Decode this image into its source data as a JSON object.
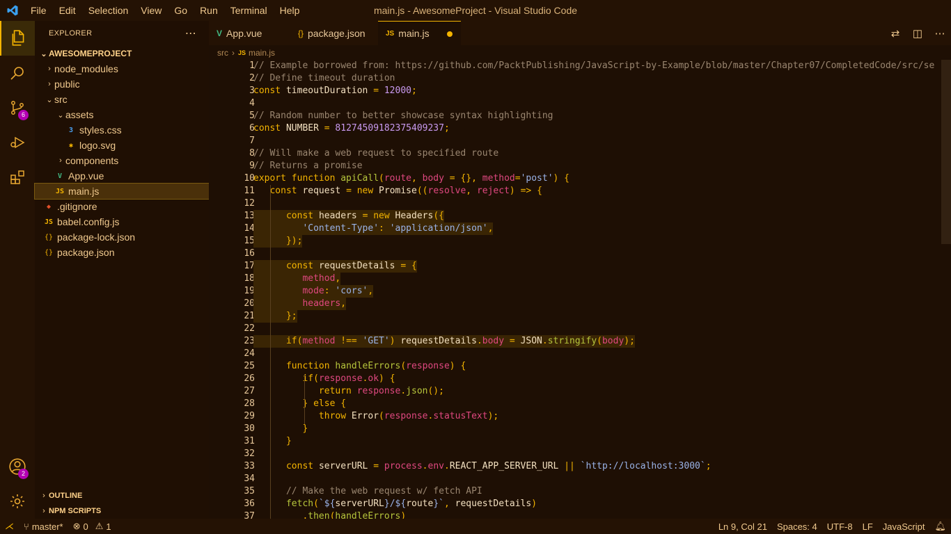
{
  "window": {
    "title": "main.js - AwesomeProject - Visual Studio Code"
  },
  "menu": [
    "File",
    "Edit",
    "Selection",
    "View",
    "Go",
    "Run",
    "Terminal",
    "Help"
  ],
  "activity": {
    "scm_badge": "6",
    "accounts_badge": "2"
  },
  "sidebar": {
    "title": "EXPLORER",
    "project": "AWESOMEPROJECT",
    "items": [
      {
        "label": "node_modules",
        "type": "folder",
        "depth": 1,
        "open": false
      },
      {
        "label": "public",
        "type": "folder",
        "depth": 1,
        "open": false
      },
      {
        "label": "src",
        "type": "folder",
        "depth": 1,
        "open": true
      },
      {
        "label": "assets",
        "type": "folder",
        "depth": 2,
        "open": true
      },
      {
        "label": "styles.css",
        "type": "css",
        "depth": 3
      },
      {
        "label": "logo.svg",
        "type": "svg",
        "depth": 3
      },
      {
        "label": "components",
        "type": "folder",
        "depth": 2,
        "open": false
      },
      {
        "label": "App.vue",
        "type": "vue",
        "depth": 2
      },
      {
        "label": "main.js",
        "type": "js",
        "depth": 2,
        "selected": true
      },
      {
        "label": ".gitignore",
        "type": "git",
        "depth": 1
      },
      {
        "label": "babel.config.js",
        "type": "js",
        "depth": 1
      },
      {
        "label": "package-lock.json",
        "type": "json",
        "depth": 1
      },
      {
        "label": "package.json",
        "type": "json",
        "depth": 1
      }
    ],
    "outline": "OUTLINE",
    "npm_scripts": "NPM SCRIPTS"
  },
  "tabs": [
    {
      "label": "App.vue",
      "icon": "vue-icon"
    },
    {
      "label": "package.json",
      "icon": "json-icon"
    },
    {
      "label": "main.js",
      "icon": "js-icon",
      "active": true,
      "modified": true
    }
  ],
  "breadcrumb": {
    "folder": "src",
    "file": "main.js"
  },
  "code": [
    [
      [
        "c-com",
        "// Example borrowed from: https://github.com/PacktPublishing/JavaScript-by-Example/blob/master/Chapter07/CompletedCode/src/se"
      ]
    ],
    [
      [
        "c-com",
        "// Define timeout duration"
      ]
    ],
    [
      [
        "c-kw",
        "const "
      ],
      [
        "c-id",
        "timeoutDuration "
      ],
      [
        "c-kw",
        "= "
      ],
      [
        "c-num",
        "12000"
      ],
      [
        "c-kw",
        ";"
      ]
    ],
    [],
    [
      [
        "c-com",
        "// Random number to better showcase syntax highlighting"
      ]
    ],
    [
      [
        "c-kw",
        "const "
      ],
      [
        "c-id",
        "NUMBER "
      ],
      [
        "c-kw",
        "= "
      ],
      [
        "c-num",
        "81274509182375409237"
      ],
      [
        "c-kw",
        ";"
      ]
    ],
    [],
    [
      [
        "c-com",
        "// Will make a web request to specified route"
      ]
    ],
    [
      [
        "c-com",
        "// Returns a promise"
      ]
    ],
    [
      [
        "c-kw",
        "export function "
      ],
      [
        "c-fn",
        "apiCall"
      ],
      [
        "c-br",
        "("
      ],
      [
        "c-par",
        "route"
      ],
      [
        "c-kw",
        ", "
      ],
      [
        "c-par",
        "body "
      ],
      [
        "c-kw",
        "= "
      ],
      [
        "c-br",
        "{}"
      ],
      [
        "c-kw",
        ", "
      ],
      [
        "c-par",
        "method"
      ],
      [
        "c-kw",
        "="
      ],
      [
        "c-str",
        "'post'"
      ],
      [
        "c-br",
        ") {"
      ]
    ],
    [
      [
        "c-id",
        "   "
      ],
      [
        "c-kw",
        "const "
      ],
      [
        "c-id",
        "request "
      ],
      [
        "c-kw",
        "= new "
      ],
      [
        "c-id",
        "Promise"
      ],
      [
        "c-br",
        "(("
      ],
      [
        "c-par",
        "resolve"
      ],
      [
        "c-kw",
        ", "
      ],
      [
        "c-par",
        "reject"
      ],
      [
        "c-br",
        ") "
      ],
      [
        "c-kw",
        "=> "
      ],
      [
        "c-br",
        "{"
      ]
    ],
    [],
    [
      [
        "c-id",
        "      "
      ],
      [
        "c-kw",
        "const "
      ],
      [
        "c-id",
        "headers "
      ],
      [
        "c-kw",
        "= new "
      ],
      [
        "c-id",
        "Headers"
      ],
      [
        "c-br",
        "({"
      ]
    ],
    [
      [
        "c-id",
        "         "
      ],
      [
        "c-str",
        "'Content-Type'"
      ],
      [
        "c-kw",
        ": "
      ],
      [
        "c-str",
        "'application/json'"
      ],
      [
        "c-kw",
        ","
      ]
    ],
    [
      [
        "c-id",
        "      "
      ],
      [
        "c-br",
        "})"
      ],
      [
        "c-kw",
        ";"
      ]
    ],
    [],
    [
      [
        "c-id",
        "      "
      ],
      [
        "c-kw",
        "const "
      ],
      [
        "c-id",
        "requestDetails "
      ],
      [
        "c-kw",
        "= "
      ],
      [
        "c-br",
        "{"
      ]
    ],
    [
      [
        "c-id",
        "         "
      ],
      [
        "c-par",
        "method"
      ],
      [
        "c-kw",
        ","
      ]
    ],
    [
      [
        "c-id",
        "         "
      ],
      [
        "c-par",
        "mode"
      ],
      [
        "c-kw",
        ": "
      ],
      [
        "c-str",
        "'cors'"
      ],
      [
        "c-kw",
        ","
      ]
    ],
    [
      [
        "c-id",
        "         "
      ],
      [
        "c-par",
        "headers"
      ],
      [
        "c-kw",
        ","
      ]
    ],
    [
      [
        "c-id",
        "      "
      ],
      [
        "c-br",
        "}"
      ],
      [
        "c-kw",
        ";"
      ]
    ],
    [],
    [
      [
        "c-id",
        "      "
      ],
      [
        "c-kw",
        "if"
      ],
      [
        "c-br",
        "("
      ],
      [
        "c-par",
        "method "
      ],
      [
        "c-kw",
        "!== "
      ],
      [
        "c-str",
        "'GET'"
      ],
      [
        "c-br",
        ") "
      ],
      [
        "c-id",
        "requestDetails"
      ],
      [
        "c-kw",
        "."
      ],
      [
        "c-par",
        "body "
      ],
      [
        "c-kw",
        "= "
      ],
      [
        "c-id",
        "JSON"
      ],
      [
        "c-kw",
        "."
      ],
      [
        "c-fn",
        "stringify"
      ],
      [
        "c-br",
        "("
      ],
      [
        "c-par",
        "body"
      ],
      [
        "c-br",
        ")"
      ],
      [
        "c-kw",
        ";"
      ]
    ],
    [],
    [
      [
        "c-id",
        "      "
      ],
      [
        "c-kw",
        "function "
      ],
      [
        "c-fn",
        "handleErrors"
      ],
      [
        "c-br",
        "("
      ],
      [
        "c-par",
        "response"
      ],
      [
        "c-br",
        ") {"
      ]
    ],
    [
      [
        "c-id",
        "         "
      ],
      [
        "c-kw",
        "if"
      ],
      [
        "c-br",
        "("
      ],
      [
        "c-par",
        "response"
      ],
      [
        "c-kw",
        "."
      ],
      [
        "c-par",
        "ok"
      ],
      [
        "c-br",
        ") {"
      ]
    ],
    [
      [
        "c-id",
        "            "
      ],
      [
        "c-kw",
        "return "
      ],
      [
        "c-par",
        "response"
      ],
      [
        "c-kw",
        "."
      ],
      [
        "c-fn",
        "json"
      ],
      [
        "c-br",
        "()"
      ],
      [
        "c-kw",
        ";"
      ]
    ],
    [
      [
        "c-id",
        "         "
      ],
      [
        "c-br",
        "} "
      ],
      [
        "c-kw",
        "else "
      ],
      [
        "c-br",
        "{"
      ]
    ],
    [
      [
        "c-id",
        "            "
      ],
      [
        "c-kw",
        "throw "
      ],
      [
        "c-id",
        "Error"
      ],
      [
        "c-br",
        "("
      ],
      [
        "c-par",
        "response"
      ],
      [
        "c-kw",
        "."
      ],
      [
        "c-par",
        "statusText"
      ],
      [
        "c-br",
        ")"
      ],
      [
        "c-kw",
        ";"
      ]
    ],
    [
      [
        "c-id",
        "         "
      ],
      [
        "c-br",
        "}"
      ]
    ],
    [
      [
        "c-id",
        "      "
      ],
      [
        "c-br",
        "}"
      ]
    ],
    [],
    [
      [
        "c-id",
        "      "
      ],
      [
        "c-kw",
        "const "
      ],
      [
        "c-id",
        "serverURL "
      ],
      [
        "c-kw",
        "= "
      ],
      [
        "c-par",
        "process"
      ],
      [
        "c-kw",
        "."
      ],
      [
        "c-par",
        "env"
      ],
      [
        "c-kw",
        "."
      ],
      [
        "c-id",
        "REACT_APP_SERVER_URL "
      ],
      [
        "c-kw",
        "|| "
      ],
      [
        "c-str",
        "`http://localhost:3000`"
      ],
      [
        "c-kw",
        ";"
      ]
    ],
    [],
    [
      [
        "c-id",
        "      "
      ],
      [
        "c-com",
        "// Make the web request w/ fetch API"
      ]
    ],
    [
      [
        "c-id",
        "      "
      ],
      [
        "c-fn",
        "fetch"
      ],
      [
        "c-br",
        "("
      ],
      [
        "c-str",
        "`${"
      ],
      [
        "c-id",
        "serverURL"
      ],
      [
        "c-str",
        "}/${"
      ],
      [
        "c-id",
        "route"
      ],
      [
        "c-str",
        "}`"
      ],
      [
        "c-kw",
        ", "
      ],
      [
        "c-id",
        "requestDetails"
      ],
      [
        "c-br",
        ")"
      ]
    ],
    [
      [
        "c-id",
        "         "
      ],
      [
        "c-kw",
        "."
      ],
      [
        "c-fn",
        "then"
      ],
      [
        "c-br",
        "("
      ],
      [
        "c-fn",
        "handleErrors"
      ],
      [
        "c-br",
        ")"
      ]
    ]
  ],
  "highlighted_lines": [
    13,
    14,
    15,
    17,
    18,
    19,
    20,
    21,
    23
  ],
  "status": {
    "branch": "master*",
    "errors": "0",
    "warnings": "1",
    "position": "Ln 9, Col 21",
    "spaces": "Spaces: 4",
    "encoding": "UTF-8",
    "eol": "LF",
    "language": "JavaScript"
  },
  "colors": {
    "accent": "#f4b400",
    "background": "#1e0f04",
    "badge": "#b300b3"
  }
}
